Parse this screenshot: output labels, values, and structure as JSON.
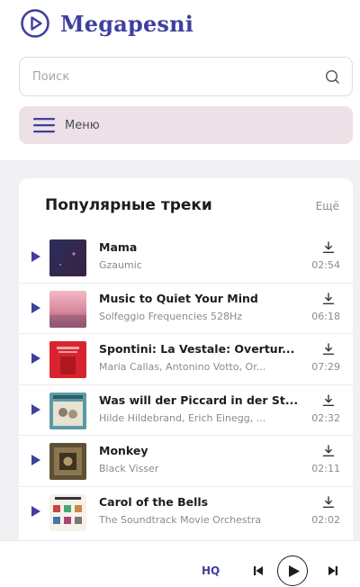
{
  "app": {
    "brand": "Megapesni"
  },
  "search": {
    "placeholder": "Поиск"
  },
  "menu": {
    "label": "Меню"
  },
  "popular": {
    "title": "Популярные треки",
    "more": "Ещё",
    "tracks": [
      {
        "title": "Mama",
        "artist": "Gzaumic",
        "duration": "02:54"
      },
      {
        "title": "Music to Quiet Your Mind",
        "artist": "Solfeggio Frequencies 528Hz",
        "duration": "06:18"
      },
      {
        "title": "Spontini: La Vestale: Overtur...",
        "artist": "Maria Callas, Antonino Votto, Or...",
        "duration": "07:29"
      },
      {
        "title": "Was will der Piccard in der St...",
        "artist": "Hilde Hildebrand, Erich Einegg, ...",
        "duration": "02:32"
      },
      {
        "title": "Monkey",
        "artist": "Black Visser",
        "duration": "02:11"
      },
      {
        "title": "Carol of the Bells",
        "artist": "The Soundtrack Movie Orchestra",
        "duration": "02:02"
      }
    ]
  },
  "player": {
    "quality": "HQ"
  },
  "colors": {
    "brand": "#3f3fa0",
    "menu_bg": "#ede0e6",
    "page_bg": "#f1f1f4"
  },
  "icons": [
    "play-circle-icon",
    "search-icon",
    "hamburger-icon",
    "play-icon",
    "download-icon",
    "skip-previous-icon",
    "skip-next-icon"
  ]
}
